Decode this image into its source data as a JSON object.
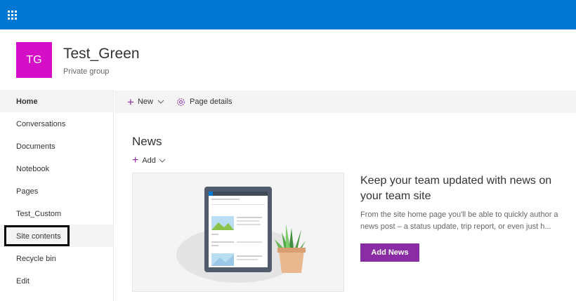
{
  "suite_bar": {
    "accent": "#0078d4",
    "app_launcher_icon": "waffle-icon"
  },
  "site": {
    "logo_initials": "TG",
    "logo_color": "#d50fc8",
    "title": "Test_Green",
    "subtitle": "Private group"
  },
  "nav": {
    "items": [
      {
        "label": "Home",
        "selected": true
      },
      {
        "label": "Conversations"
      },
      {
        "label": "Documents"
      },
      {
        "label": "Notebook"
      },
      {
        "label": "Pages"
      },
      {
        "label": "Test_Custom"
      },
      {
        "label": "Site contents",
        "highlighted": true
      },
      {
        "label": "Recycle bin"
      },
      {
        "label": "Edit"
      }
    ]
  },
  "command_bar": {
    "new_label": "New",
    "page_details_label": "Page details"
  },
  "news": {
    "title": "News",
    "add_label": "Add",
    "heading": "Keep your team updated with news on your team site",
    "body": "From the site home page you'll be able to quickly author a news post – a status update, trip report, or even just h...",
    "add_news_label": "Add News",
    "accent": "#8a2da5"
  }
}
